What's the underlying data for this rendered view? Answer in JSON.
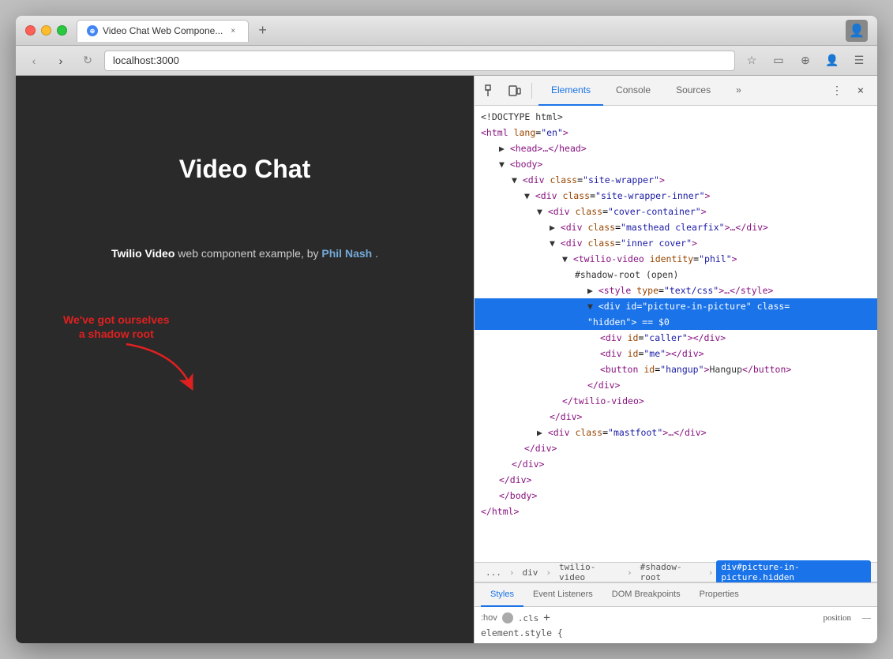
{
  "browser": {
    "traffic_lights": [
      "close",
      "minimize",
      "maximize"
    ],
    "tab_title": "Video Chat Web Compone...",
    "tab_close": "×",
    "new_tab": "+",
    "address": "localhost:3000",
    "nav_back": "‹",
    "nav_forward": "›",
    "nav_reload": "↻"
  },
  "devtools": {
    "toolbar_icon1": "⬚",
    "toolbar_icon2": "⬡",
    "tabs": [
      "Elements",
      "Console",
      "Sources",
      "»"
    ],
    "active_tab": "Elements",
    "close_btn": "×",
    "more_btn": "⋮"
  },
  "dom_tree": {
    "lines": [
      {
        "indent": 0,
        "content": "<!DOCTYPE html>",
        "type": "doctype"
      },
      {
        "indent": 0,
        "content": "<html lang=\"en\">",
        "type": "open-tag"
      },
      {
        "indent": 1,
        "content": "▶ <head>…</head>",
        "type": "collapsed"
      },
      {
        "indent": 1,
        "content": "▼ <body>",
        "type": "open"
      },
      {
        "indent": 2,
        "content": "▼ <div class=\"site-wrapper\">",
        "type": "open"
      },
      {
        "indent": 3,
        "content": "▼ <div class=\"site-wrapper-inner\">",
        "type": "open"
      },
      {
        "indent": 4,
        "content": "▼ <div class=\"cover-container\">",
        "type": "open"
      },
      {
        "indent": 5,
        "content": "▶ <div class=\"masthead clearfix\">…</div>",
        "type": "collapsed"
      },
      {
        "indent": 5,
        "content": "▼ <div class=\"inner cover\">",
        "type": "open"
      },
      {
        "indent": 6,
        "content": "▼ <twilio-video identity=\"phil\">",
        "type": "open"
      },
      {
        "indent": 7,
        "content": "#shadow-root (open)",
        "type": "shadow"
      },
      {
        "indent": 8,
        "content": "▶ <style type=\"text/css\">…</style>",
        "type": "collapsed"
      },
      {
        "indent": 8,
        "content": "▼ <div id=\"picture-in-picture\" class=",
        "type": "open",
        "selected": true
      },
      {
        "indent": 8,
        "content": "\"hidden\"> == $0",
        "type": "continued",
        "selected": true
      },
      {
        "indent": 9,
        "content": "<div id=\"caller\"></div>",
        "type": "leaf"
      },
      {
        "indent": 9,
        "content": "<div id=\"me\"></div>",
        "type": "leaf"
      },
      {
        "indent": 9,
        "content": "<button id=\"hangup\">Hangup</button>",
        "type": "leaf"
      },
      {
        "indent": 9,
        "content": "</div>",
        "type": "close"
      },
      {
        "indent": 7,
        "content": "</twilio-video>",
        "type": "close"
      },
      {
        "indent": 6,
        "content": "</div>",
        "type": "close"
      },
      {
        "indent": 5,
        "content": "▶ <div class=\"mastfoot\">…</div>",
        "type": "collapsed"
      },
      {
        "indent": 4,
        "content": "</div>",
        "type": "close"
      },
      {
        "indent": 3,
        "content": "</div>",
        "type": "close"
      },
      {
        "indent": 2,
        "content": "</div>",
        "type": "close"
      },
      {
        "indent": 1,
        "content": "</body>",
        "type": "close"
      },
      {
        "indent": 0,
        "content": "</html>",
        "type": "close"
      }
    ]
  },
  "breadcrumb": {
    "items": [
      "...",
      "div",
      "twilio-video",
      "#shadow-root",
      "div#picture-in-picture.hidden"
    ]
  },
  "bottom_panel": {
    "tabs": [
      "Styles",
      "Event Listeners",
      "DOM Breakpoints",
      "Properties"
    ],
    "active_tab": "Styles",
    "filter_placeholder": ":hov",
    "filter_cls": ".cls",
    "rule": "element.style {",
    "position_label": "position",
    "position_dash": "—"
  },
  "page": {
    "title": "Video Chat",
    "subtitle_bold": "Twilio Video",
    "subtitle_text": " web component example, by ",
    "subtitle_link": "Phil Nash",
    "subtitle_end": "."
  },
  "annotation": {
    "text_line1": "We've got ourselves",
    "text_line2": "a shadow root"
  }
}
